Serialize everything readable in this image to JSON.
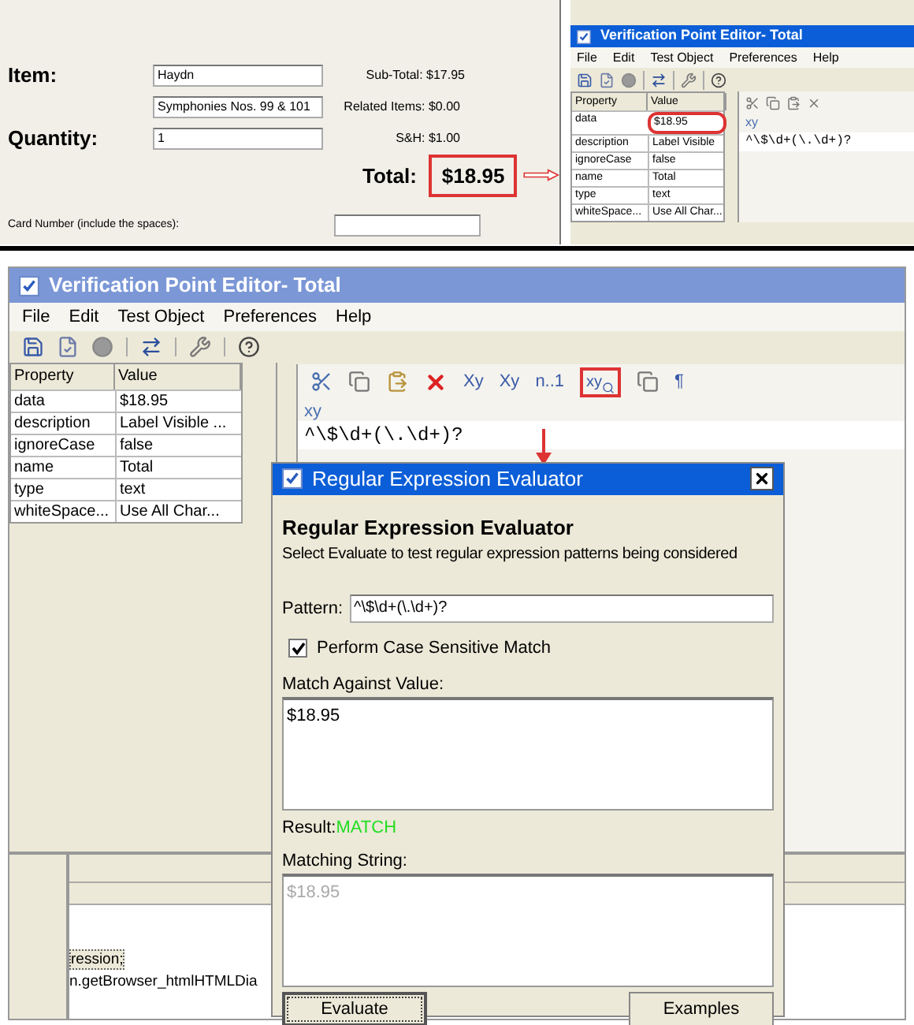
{
  "order_form": {
    "item_label": "Item:",
    "item_fields": [
      "Haydn",
      "Symphonies Nos. 99 & 101"
    ],
    "quantity_label": "Quantity:",
    "quantity_value": "1",
    "summary": [
      "Sub-Total: $17.95",
      "Related Items: $0.00",
      "S&H: $1.00"
    ],
    "total_label": "Total:",
    "total_value": "$18.95",
    "total_highlighted": true,
    "card_label": "Card Number (include the spaces):"
  },
  "small_editor": {
    "title": "Verification Point Editor- Total",
    "menu": [
      "File",
      "Edit",
      "Test Object",
      "Preferences",
      "Help"
    ],
    "columns": [
      "Property",
      "Value"
    ],
    "rows": [
      {
        "property": "data",
        "value": "$18.95",
        "highlighted": true
      },
      {
        "property": "description",
        "value": "Label Visible",
        "highlighted": false
      },
      {
        "property": "ignoreCase",
        "value": "false",
        "highlighted": false
      },
      {
        "property": "name",
        "value": "Total",
        "highlighted": false
      },
      {
        "property": "type",
        "value": "text",
        "highlighted": false
      },
      {
        "property": "whiteSpace...",
        "value": "Use All Char...",
        "highlighted": false
      }
    ],
    "pane_label": "xy",
    "pattern": "^\\$\\d+(\\.\\d+)?"
  },
  "editor": {
    "title": "Verification Point Editor- Total",
    "menu": [
      "File",
      "Edit",
      "Test Object",
      "Preferences",
      "Help"
    ],
    "columns": [
      "Property",
      "Value"
    ],
    "rows": [
      {
        "property": "data",
        "value": "$18.95"
      },
      {
        "property": "description",
        "value": "Label Visible ..."
      },
      {
        "property": "ignoreCase",
        "value": "false"
      },
      {
        "property": "name",
        "value": "Total"
      },
      {
        "property": "type",
        "value": "text"
      },
      {
        "property": "whiteSpace...",
        "value": "Use All Char..."
      }
    ],
    "pane_tools": [
      {
        "kind": "cut"
      },
      {
        "kind": "copy"
      },
      {
        "kind": "paste"
      },
      {
        "kind": "delete"
      },
      {
        "kind": "text",
        "text": "Xy",
        "highlighted": false
      },
      {
        "kind": "text",
        "text": "Xy",
        "highlighted": false
      },
      {
        "kind": "text",
        "text": "n..1",
        "highlighted": false
      },
      {
        "kind": "regex",
        "text": "xy",
        "highlighted": true
      },
      {
        "kind": "copy"
      },
      {
        "kind": "text",
        "text": "¶",
        "highlighted": false
      }
    ],
    "pane_label": "xy",
    "pattern": "^\\$\\d+(\\.\\d+)?",
    "code_lines": [
      "ression;",
      "n.getBrowser_htmlHTMLDia"
    ]
  },
  "dialog": {
    "title": "Regular Expression Evaluator",
    "heading": "Regular Expression Evaluator",
    "subtitle": "Select Evaluate to test regular expression patterns being considered",
    "pattern_label": "Pattern:",
    "pattern": "^\\$\\d+(\\.\\d+)?",
    "case_sensitive": true,
    "case_label": "Perform Case Sensitive Match",
    "match_label": "Match Against Value:",
    "match_value": "$18.95",
    "result_label": "Result:",
    "result": "MATCH",
    "matching_label": "Matching String:",
    "matching_value": "$18.95",
    "buttons": [
      "Evaluate",
      "Examples"
    ]
  }
}
